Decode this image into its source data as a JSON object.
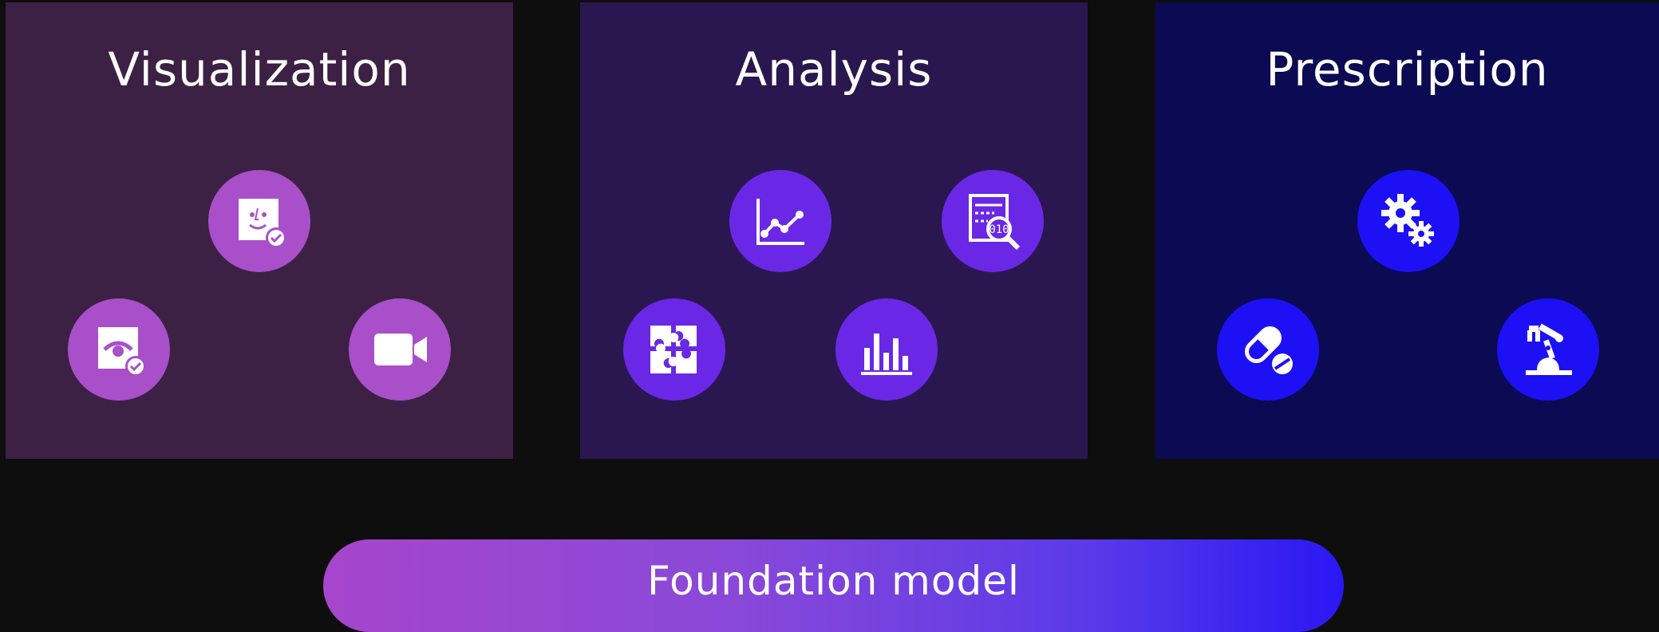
{
  "panels": [
    {
      "title": "Visualization",
      "color": "#3c2144",
      "icon_color": "#a94fc9",
      "icons": [
        "face-recognition-icon",
        "visibility-check-icon",
        "video-camera-icon"
      ]
    },
    {
      "title": "Analysis",
      "color": "#2a1750",
      "icon_color": "#6a28e6",
      "icons": [
        "line-chart-icon",
        "data-search-icon",
        "puzzle-icon",
        "bar-chart-icon"
      ]
    },
    {
      "title": "Prescription",
      "color": "#0b0a52",
      "icon_color": "#1d10f5",
      "icons": [
        "gears-icon",
        "pill-icon",
        "robotic-arm-icon"
      ]
    }
  ],
  "foundation": {
    "label": "Foundation model"
  }
}
